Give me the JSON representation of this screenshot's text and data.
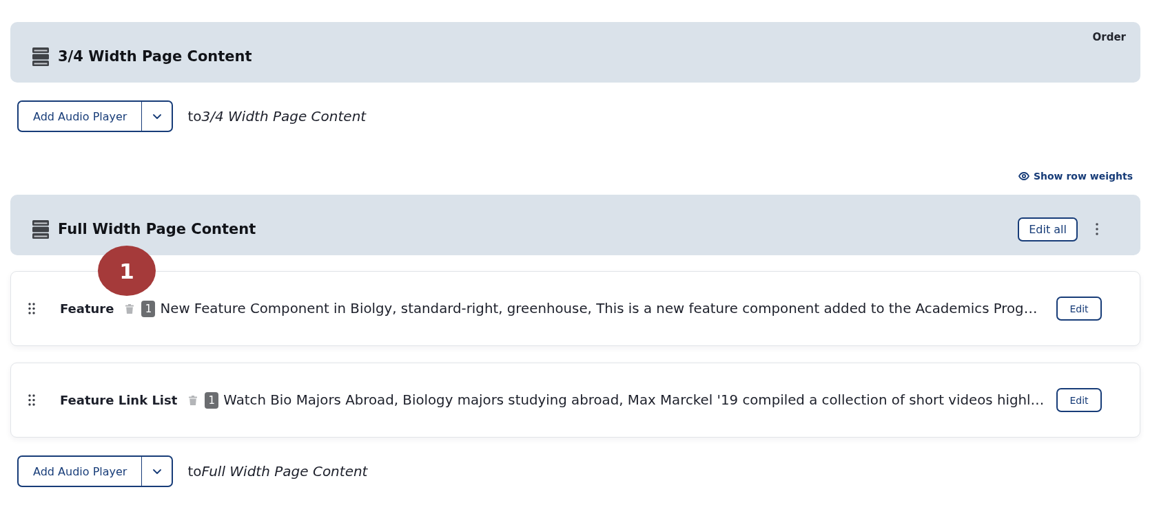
{
  "sections": [
    {
      "title": "3/4 Width Page Content",
      "order_label": "Order",
      "add_button": "Add Audio Player",
      "add_prefix": "to",
      "add_target": "3/4 Width Page Content"
    },
    {
      "link": "Show row weights",
      "title": "Full Width Page Content",
      "edit_all_button": "Edit all",
      "items": [
        {
          "title": "Feature",
          "count": "1",
          "summary": "New Feature Component in Biolgy, standard-right, greenhouse, This is a new feature component added to the Academics Prog…",
          "edit_button": "Edit"
        },
        {
          "title": "Feature Link List",
          "count": "1",
          "summary": "Watch Bio Majors Abroad, Biology majors studying abroad, Max Marckel '19 compiled a collection of short videos highl…",
          "edit_button": "Edit"
        }
      ],
      "add_button": "Add Audio Player",
      "add_prefix": "to",
      "add_target": "Full Width Page Content"
    }
  ],
  "annotation": {
    "label": "1"
  }
}
